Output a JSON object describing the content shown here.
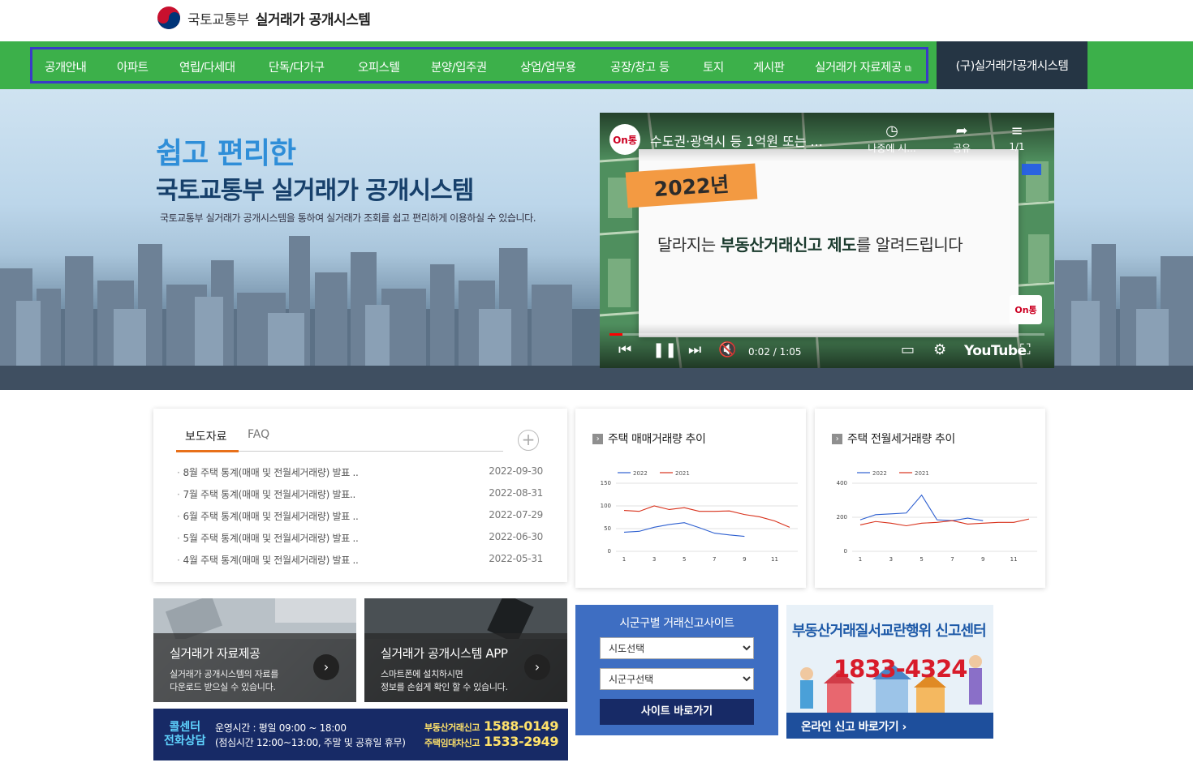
{
  "header": {
    "ministry": "국토교통부",
    "system": "실거래가 공개시스템"
  },
  "gnb": {
    "items": [
      "공개안내",
      "아파트",
      "연립/다세대",
      "단독/다가구",
      "오피스텔",
      "분양/입주권",
      "상업/업무용",
      "공장/창고 등",
      "토지",
      "게시판",
      "실거래가 자료제공"
    ],
    "old_system": "(구)실거래가공개시스템"
  },
  "hero": {
    "tagline": "쉽고 편리한",
    "title": "국토교통부 실거래가 공개시스템",
    "description": "국토교통부 실거래가 공개시스템을 통하여 실거래가 조회를 쉽고 편리하게 이용하실 수 있습니다."
  },
  "video": {
    "title": "수도권·광역시 등 1억원 또는 ...",
    "channel": "On통",
    "watch_later": "나중에 시...",
    "share": "공유",
    "playlist": "1/1",
    "year_tag": "2022년",
    "headline_prefix": "달라지는 ",
    "headline_bold": "부동산거래신고 제도",
    "headline_suffix": "를 알려드립니다",
    "time": "0:02 / 1:05",
    "brand": "YouTube",
    "progress": 0.03
  },
  "notice": {
    "tabs": [
      "보도자료",
      "FAQ"
    ],
    "items": [
      {
        "title": "8월 주택 통계(매매 및 전월세거래량) 발표 ..",
        "date": "2022-09-30"
      },
      {
        "title": "7월 주택 통계(매매 및 전월세거래량) 발표..",
        "date": "2022-08-31"
      },
      {
        "title": "6월 주택 통계(매매 및 전월세거래량) 발표 ..",
        "date": "2022-07-29"
      },
      {
        "title": "5월 주택 통계(매매 및 전월세거래량) 발표 ..",
        "date": "2022-06-30"
      },
      {
        "title": "4월 주택 통계(매매 및 전월세거래량) 발표 ..",
        "date": "2022-05-31"
      }
    ]
  },
  "charts": {
    "sale_title": "주택 매매거래량 추이",
    "rent_title": "주택 전월세거래량 추이"
  },
  "chart_data": [
    {
      "type": "line",
      "title": "주택 매매거래량 추이",
      "x": [
        1,
        2,
        3,
        4,
        5,
        6,
        7,
        8,
        9,
        10,
        11,
        12
      ],
      "xticks": [
        "1",
        "3",
        "5",
        "7",
        "9",
        "11"
      ],
      "yticks": [
        "0",
        "50",
        "100",
        "150"
      ],
      "ylim": [
        0,
        150
      ],
      "series": [
        {
          "name": "2022",
          "color": "#2d5fd0",
          "values": [
            42,
            44,
            53,
            59,
            63,
            52,
            40,
            36,
            33,
            null,
            null,
            null
          ]
        },
        {
          "name": "2021",
          "color": "#d8301a",
          "values": [
            90,
            88,
            100,
            92,
            96,
            88,
            88,
            89,
            81,
            76,
            67,
            53
          ]
        }
      ]
    },
    {
      "type": "line",
      "title": "주택 전월세거래량 추이",
      "x": [
        1,
        2,
        3,
        4,
        5,
        6,
        7,
        8,
        9,
        10,
        11,
        12
      ],
      "xticks": [
        "1",
        "3",
        "5",
        "7",
        "9",
        "11"
      ],
      "yticks": [
        "0",
        "200",
        "400"
      ],
      "ylim": [
        0,
        400
      ],
      "series": [
        {
          "name": "2022",
          "color": "#2d5fd0",
          "values": [
            185,
            215,
            220,
            225,
            330,
            185,
            180,
            195,
            180,
            null,
            null,
            null
          ]
        },
        {
          "name": "2021",
          "color": "#d8301a",
          "values": [
            155,
            175,
            165,
            150,
            165,
            170,
            180,
            160,
            165,
            170,
            170,
            190
          ]
        }
      ]
    }
  ],
  "banners": [
    {
      "title": "실거래가 자료제공",
      "desc1": "실거래가 공개시스템의 자료를",
      "desc2": "다운로드 받으실 수 있습니다."
    },
    {
      "title": "실거래가 공개시스템 APP",
      "desc1": "스마트폰에 설치하시면",
      "desc2": "정보를 손쉽게 확인 할 수 있습니다."
    }
  ],
  "callcenter": {
    "label1": "콜센터",
    "label2": "전화상담",
    "hours1": "운영시간 : 평일 09:00 ~ 18:00",
    "hours2": "(점심시간 12:00~13:00, 주말 및 공휴일 휴무)",
    "phone1_label": "부동산거래신고",
    "phone1": "1588-0149",
    "phone2_label": "주택임대차신고",
    "phone2": "1533-2949"
  },
  "site_box": {
    "title": "시군구별 거래신고사이트",
    "select1": "시도선택",
    "select2": "시군구선택",
    "button": "사이트 바로가기"
  },
  "report": {
    "title": "부동산거래질서교란행위 신고센터",
    "number": "1833-4324",
    "link": "온라인 신고 바로가기"
  },
  "colors": {
    "gnb": "#3cb04a",
    "gnb_old": "#253544",
    "accent": "#e8701a",
    "navy": "#172a66",
    "site_blue": "#3e6ec2"
  }
}
